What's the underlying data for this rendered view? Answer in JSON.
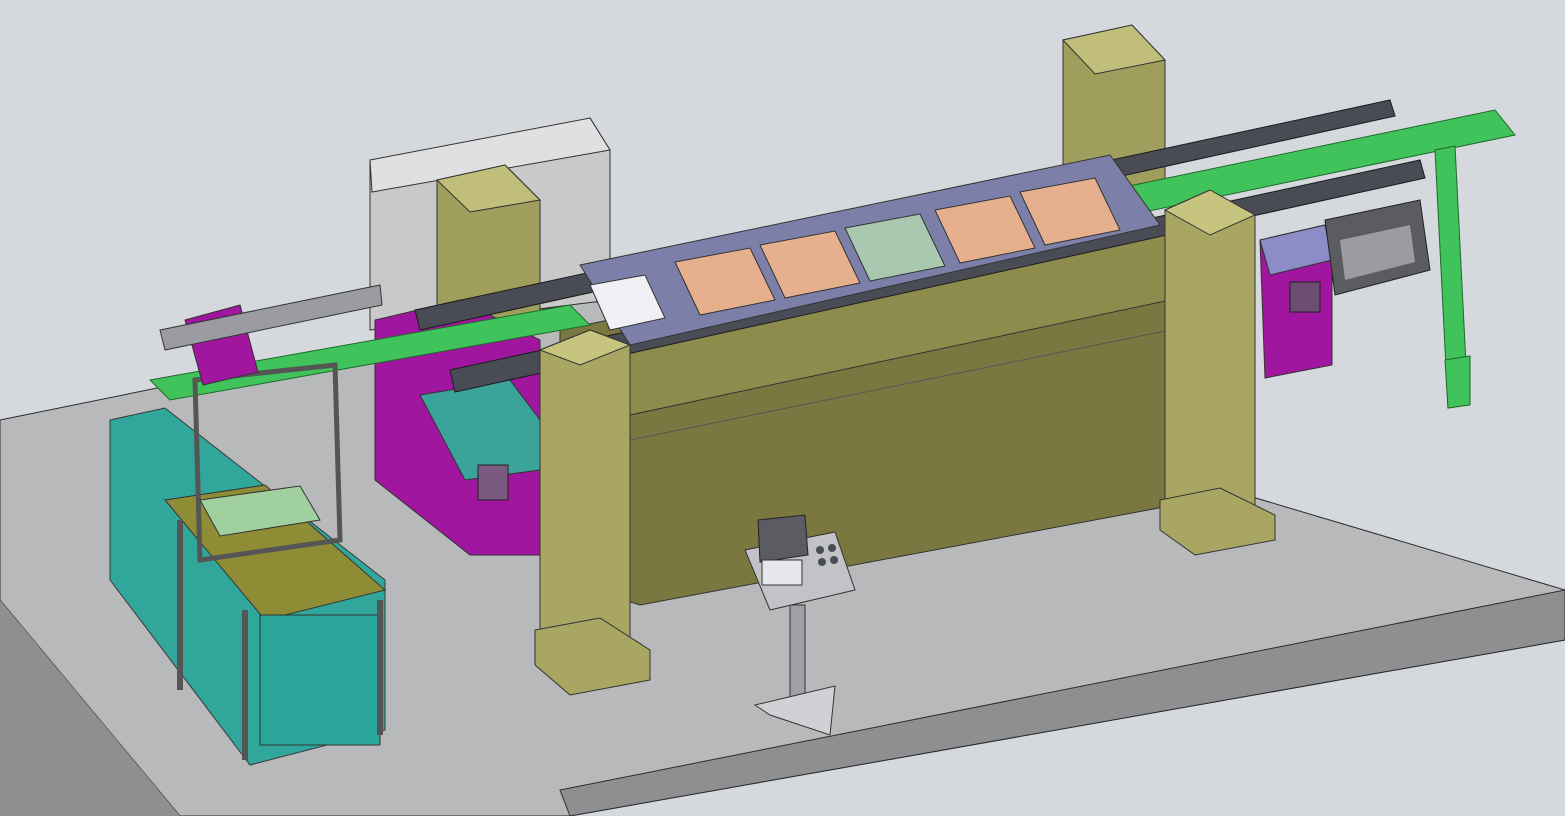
{
  "colors": {
    "background": "#d5d8dd",
    "floor_top": "#b7b9bb",
    "floor_side": "#8d8f91",
    "housing": "#c9c9c9",
    "olive": "#7a7840",
    "olive_light": "#a09e5c",
    "olive_top": "#a8a662",
    "green_rail": "#3fc35a",
    "magenta": "#a0169e",
    "teal_glass": "#2aa59a",
    "lavender": "#8b8cc8",
    "pallet_peach": "#e6b08e",
    "pallet_blue": "#a8b4d8",
    "dark_rail": "#4a4c55",
    "steel": "#9a9ca2"
  },
  "scene": {
    "description_icons": [
      "floor-platform",
      "gantry-column",
      "main-machine-base",
      "conveyor-rail",
      "inspection-station",
      "operator-control-panel",
      "loading-station"
    ]
  }
}
